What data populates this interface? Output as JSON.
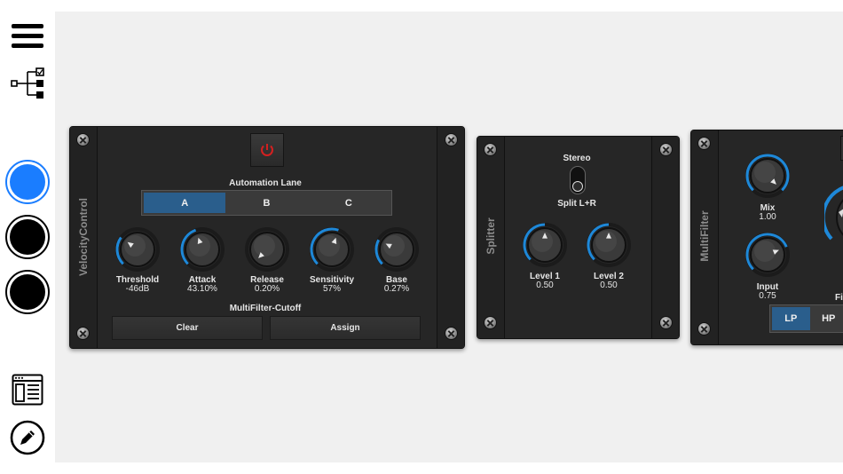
{
  "sidebar": {
    "colors": {
      "selected": "#1a7dff",
      "black": "#000000"
    }
  },
  "velocity_control": {
    "title": "VelocityControl",
    "automation_label": "Automation Lane",
    "lanes": [
      "A",
      "B",
      "C"
    ],
    "selected_lane": "A",
    "knobs": [
      {
        "label": "Threshold",
        "value": "-46dB"
      },
      {
        "label": "Attack",
        "value": "43.10%"
      },
      {
        "label": "Release",
        "value": "0.20%"
      },
      {
        "label": "Sensitivity",
        "value": "57%"
      },
      {
        "label": "Base",
        "value": "0.27%"
      }
    ],
    "target_label": "MultiFilter-Cutoff",
    "clear_label": "Clear",
    "assign_label": "Assign"
  },
  "splitter": {
    "title": "Splitter",
    "stereo_label": "Stereo",
    "split_label": "Split L+R",
    "knobs": [
      {
        "label": "Level 1",
        "value": "0.50"
      },
      {
        "label": "Level 2",
        "value": "0.50"
      }
    ]
  },
  "multifilter": {
    "title": "MultiFilter",
    "knobs": [
      {
        "label": "Mix",
        "value": "1.00"
      },
      {
        "label": "Input",
        "value": "0.75"
      }
    ],
    "partial_label": "Fi",
    "modes": [
      "LP",
      "HP"
    ],
    "selected_mode": "LP"
  },
  "colors": {
    "accent": "#1e88d8",
    "power": "#d42020",
    "lane_selected": "#2a5e8c"
  }
}
